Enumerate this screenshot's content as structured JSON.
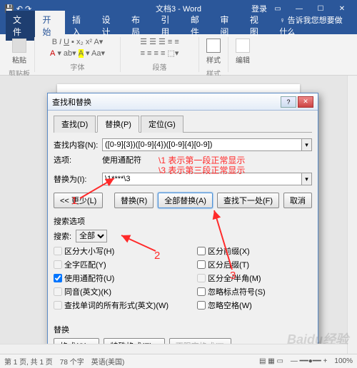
{
  "app": {
    "title": "文档3 - Word",
    "login": "登录",
    "tabs": {
      "file": "文件",
      "home": "开始",
      "insert": "插入",
      "design": "设计",
      "layout": "布局",
      "references": "引用",
      "mailings": "邮件",
      "review": "审阅",
      "view": "视图",
      "tell_me": "告诉我您想要做什么"
    },
    "ribbon": {
      "clipboard": "剪贴板",
      "paste": "粘贴",
      "font": "字体",
      "paragraph": "段落",
      "styles": "样式",
      "editing": "编辑"
    }
  },
  "dialog": {
    "title": "查找和替换",
    "tabs": {
      "find": "查找(D)",
      "replace": "替换(P)",
      "goto": "定位(G)"
    },
    "find_label": "查找内容(N):",
    "find_value": "([0-9]{3})([0-9]{4})([0-9]{4}[0-9])",
    "options_label": "选项:",
    "options_value": "使用通配符",
    "replace_label": "替换为(I):",
    "replace_value": "\\1****\\3",
    "btn_less": "<< 更少(L)",
    "btn_replace": "替换(R)",
    "btn_replace_all": "全部替换(A)",
    "btn_find_next": "查找下一处(F)",
    "btn_cancel": "取消",
    "search_options": "搜索选项",
    "search_label": "搜索:",
    "search_dir": "全部",
    "opts": {
      "match_case": "区分大小写(H)",
      "whole_word": "全字匹配(Y)",
      "wildcards": "使用通配符(U)",
      "sounds_like": "同音(英文)(K)",
      "all_forms": "查找单词的所有形式(英文)(W)",
      "prefix": "区分前缀(X)",
      "suffix": "区分后缀(T)",
      "full_half": "区分全/半角(M)",
      "ignore_punct": "忽略标点符号(S)",
      "ignore_space": "忽略空格(W)"
    },
    "replace_section": "替换",
    "btn_format": "格式(O) ▾",
    "btn_special": "特殊格式(E) ▾",
    "btn_no_format": "不限定格式(T)"
  },
  "annotations": {
    "n1": "1",
    "n2": "2",
    "n3": "3",
    "line1": "\\1 表示第一段正常显示",
    "line3": "\\3 表示第三段正常显示"
  },
  "status": {
    "page": "第 1 页, 共 1 页",
    "words": "78 个字",
    "lang": "英语(美国)",
    "zoom": "100%"
  },
  "watermark": "Baidu经验"
}
